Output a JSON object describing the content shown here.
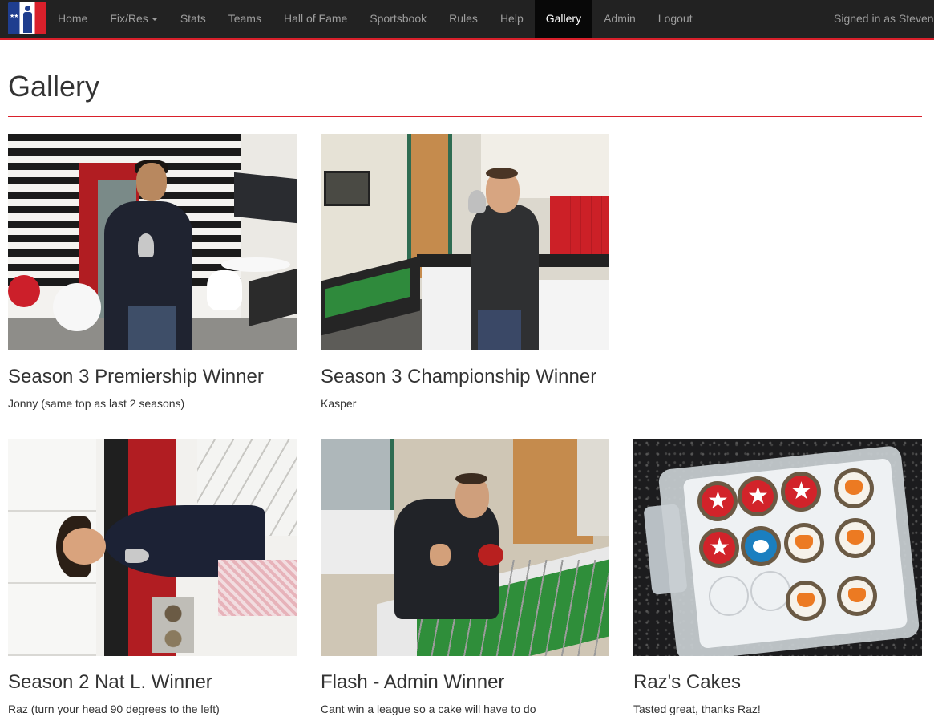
{
  "nav": {
    "brand_icon": "league-logo-icon",
    "items": [
      {
        "label": "Home"
      },
      {
        "label": "Fix/Res",
        "dropdown": true
      },
      {
        "label": "Stats"
      },
      {
        "label": "Teams"
      },
      {
        "label": "Hall of Fame"
      },
      {
        "label": "Sportsbook"
      },
      {
        "label": "Rules"
      },
      {
        "label": "Help"
      },
      {
        "label": "Gallery",
        "active": true
      },
      {
        "label": "Admin"
      },
      {
        "label": "Logout"
      }
    ],
    "signed_in": "Signed in as Steven"
  },
  "page": {
    "title": "Gallery"
  },
  "gallery": [
    {
      "title": "Season 3 Premiership Winner",
      "caption": "Jonny (same top as last 2 seasons)"
    },
    {
      "title": "Season 3 Championship Winner",
      "caption": "Kasper"
    },
    {
      "title": "Season 2 Nat L. Winner",
      "caption": "Raz (turn your head 90 degrees to the left)"
    },
    {
      "title": "Flash - Admin Winner",
      "caption": "Cant win a league so a cake will have to do"
    },
    {
      "title": "Raz's Cakes",
      "caption": "Tasted great, thanks Raz!"
    }
  ],
  "colors": {
    "navbar_bg": "#222222",
    "nav_text": "#9d9d9d",
    "accent_red": "#d9202b",
    "active_nav_bg": "#080808"
  }
}
